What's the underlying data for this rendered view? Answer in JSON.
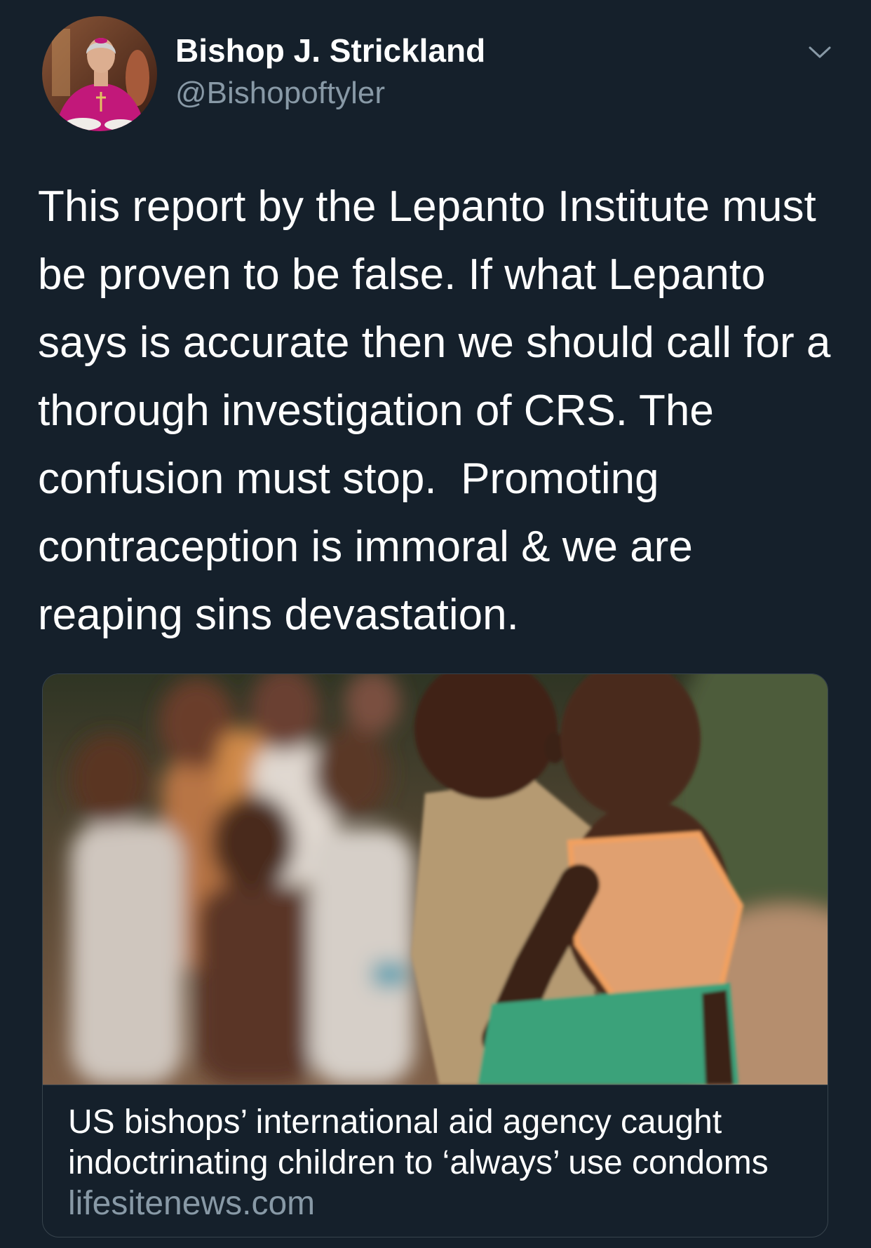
{
  "author": {
    "name": "Bishop J. Strickland",
    "handle": "@Bishopoftyler"
  },
  "icons": {
    "avatar": "profile-photo",
    "menu": "chevron-down-icon"
  },
  "tweet": {
    "lines": [
      "This report by the Lepanto Institute must",
      "be proven to be false. If what Lepanto",
      "says is accurate then we should call for a",
      "thorough investigation of CRS. The",
      "confusion must stop.  Promoting",
      "contraception is immoral & we are",
      "reaping sins devastation."
    ]
  },
  "card": {
    "title_lines": [
      "US bishops’ international aid agency caught",
      "indoctrinating children to ‘always’ use condoms"
    ],
    "domain": "lifesitenews.com"
  },
  "colors": {
    "background": "#15202b",
    "text_primary": "#ffffff",
    "text_secondary": "#8899a6",
    "border": "#38444d"
  }
}
